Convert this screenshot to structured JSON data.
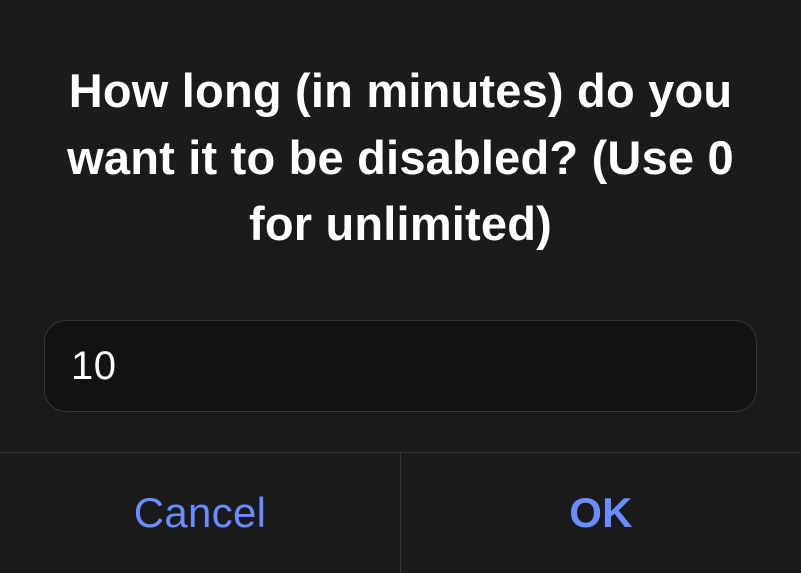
{
  "dialog": {
    "title": "How long (in minutes) do you want it to be disabled? (Use 0 for unlimited)",
    "input_value": "10",
    "buttons": {
      "cancel": "Cancel",
      "ok": "OK"
    }
  }
}
